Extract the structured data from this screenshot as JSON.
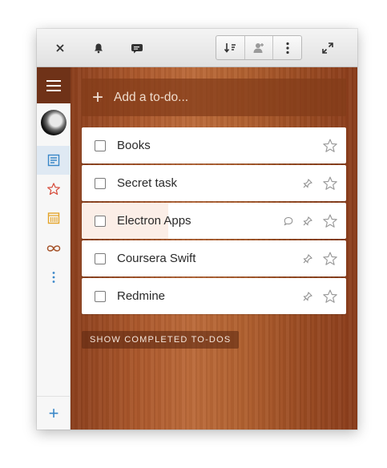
{
  "toolbar": {
    "close_icon": "close-icon",
    "alarm_icon": "alarm-bell-icon",
    "comment_icon": "comment-icon",
    "sort_icon": "sort-download-icon",
    "assign_icon": "assign-user-icon",
    "more_icon": "more-vertical-icon",
    "expand_icon": "expand-icon"
  },
  "sidebar": {
    "items": [
      {
        "name": "inbox",
        "icon": "list-icon",
        "color": "#3a87c8",
        "active": true
      },
      {
        "name": "starred",
        "icon": "star-icon",
        "color": "#d64b3a",
        "active": false
      },
      {
        "name": "week",
        "icon": "calendar-icon",
        "color": "#e4a52a",
        "active": false
      },
      {
        "name": "all",
        "icon": "infinity-icon",
        "color": "#a5532a",
        "active": false
      },
      {
        "name": "more",
        "icon": "more-vertical-icon",
        "color": "#3a87c8",
        "active": false
      }
    ],
    "add_label": "+"
  },
  "add_todo": {
    "plus": "+",
    "placeholder": "Add a to-do..."
  },
  "tasks": [
    {
      "title": "Books",
      "comment": false,
      "pinned": false
    },
    {
      "title": "Secret task",
      "comment": false,
      "pinned": true
    },
    {
      "title": "Electron Apps",
      "comment": true,
      "pinned": true
    },
    {
      "title": "Coursera Swift",
      "comment": false,
      "pinned": true
    },
    {
      "title": "Redmine",
      "comment": false,
      "pinned": true
    }
  ],
  "show_completed": "SHOW COMPLETED TO-DOS",
  "colors": {
    "sidebar_header": "#6f3218",
    "accent": "#3a87c8"
  }
}
